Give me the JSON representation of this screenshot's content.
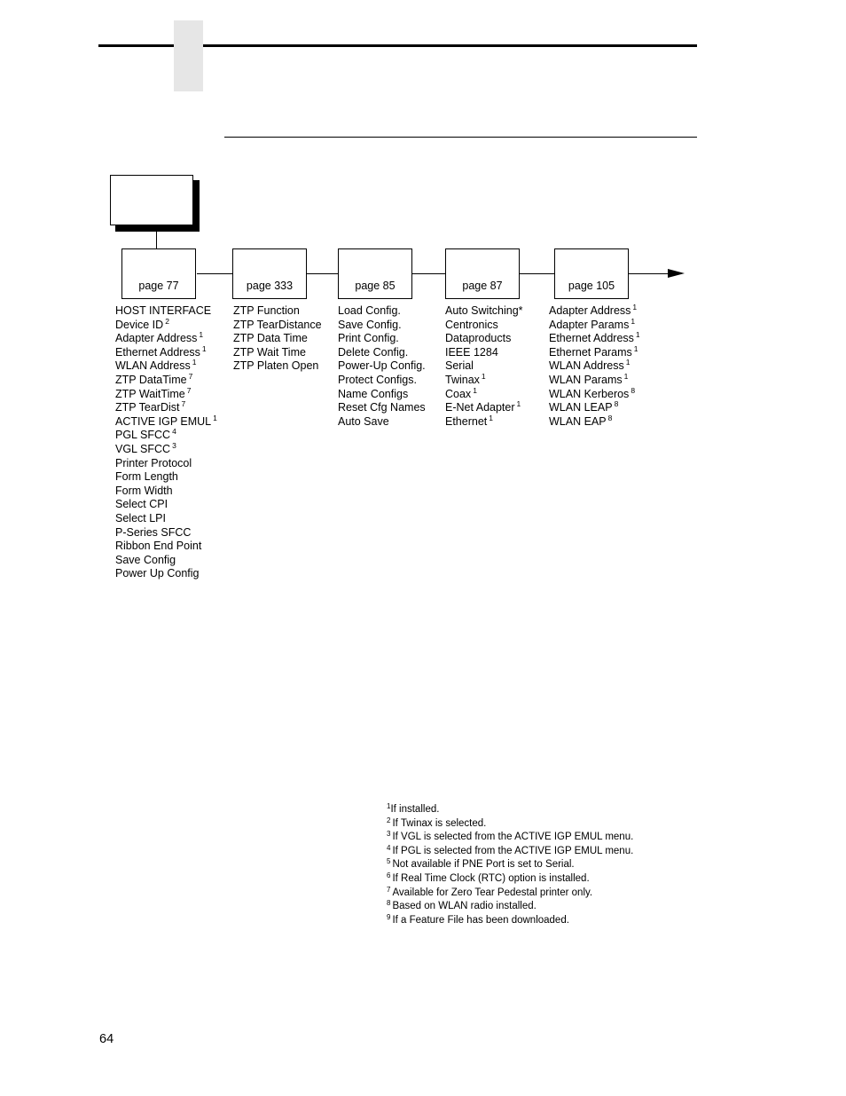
{
  "page_number": "64",
  "root_node": {
    "label": ""
  },
  "nodes": [
    {
      "label": "page 77"
    },
    {
      "label": "page 333"
    },
    {
      "label": "page 85"
    },
    {
      "label": "page 87"
    },
    {
      "label": "page 105"
    }
  ],
  "columns": [
    {
      "items": [
        {
          "text": "HOST INTERFACE",
          "sup": ""
        },
        {
          "text": "Device ID",
          "sup": "2"
        },
        {
          "text": "Adapter Address",
          "sup": "1"
        },
        {
          "text": "Ethernet Address",
          "sup": "1"
        },
        {
          "text": "WLAN Address",
          "sup": "1"
        },
        {
          "text": "ZTP DataTime",
          "sup": "7"
        },
        {
          "text": "ZTP WaitTime",
          "sup": "7"
        },
        {
          "text": "ZTP TearDist",
          "sup": "7"
        },
        {
          "text": "ACTIVE IGP EMUL",
          "sup": "1"
        },
        {
          "text": "PGL SFCC",
          "sup": "4"
        },
        {
          "text": "VGL SFCC",
          "sup": "3"
        },
        {
          "text": "Printer Protocol",
          "sup": ""
        },
        {
          "text": "Form Length",
          "sup": ""
        },
        {
          "text": "Form Width",
          "sup": ""
        },
        {
          "text": "Select CPI",
          "sup": ""
        },
        {
          "text": "Select LPI",
          "sup": ""
        },
        {
          "text": "P-Series SFCC",
          "sup": ""
        },
        {
          "text": "Ribbon End Point",
          "sup": ""
        },
        {
          "text": "Save Config",
          "sup": ""
        },
        {
          "text": "Power Up Config",
          "sup": ""
        }
      ]
    },
    {
      "items": [
        {
          "text": "ZTP Function",
          "sup": ""
        },
        {
          "text": "ZTP TearDistance",
          "sup": ""
        },
        {
          "text": "ZTP Data Time",
          "sup": ""
        },
        {
          "text": "ZTP Wait Time",
          "sup": ""
        },
        {
          "text": "ZTP Platen Open",
          "sup": ""
        }
      ]
    },
    {
      "items": [
        {
          "text": "Load Config.",
          "sup": ""
        },
        {
          "text": "Save Config.",
          "sup": ""
        },
        {
          "text": "Print Config.",
          "sup": ""
        },
        {
          "text": "Delete Config.",
          "sup": ""
        },
        {
          "text": "Power-Up Config.",
          "sup": ""
        },
        {
          "text": "Protect Configs.",
          "sup": ""
        },
        {
          "text": "Name Configs",
          "sup": ""
        },
        {
          "text": "Reset Cfg Names",
          "sup": ""
        },
        {
          "text": "Auto Save",
          "sup": ""
        }
      ]
    },
    {
      "items": [
        {
          "text": "Auto Switching*",
          "sup": ""
        },
        {
          "text": "Centronics",
          "sup": ""
        },
        {
          "text": "Dataproducts",
          "sup": ""
        },
        {
          "text": "IEEE 1284",
          "sup": ""
        },
        {
          "text": "Serial",
          "sup": ""
        },
        {
          "text": "Twinax",
          "sup": "1"
        },
        {
          "text": "Coax",
          "sup": "1"
        },
        {
          "text": "E-Net Adapter",
          "sup": "1"
        },
        {
          "text": "Ethernet",
          "sup": "1"
        }
      ]
    },
    {
      "items": [
        {
          "text": "Adapter Address",
          "sup": "1"
        },
        {
          "text": "Adapter Params",
          "sup": "1"
        },
        {
          "text": "Ethernet Address",
          "sup": "1"
        },
        {
          "text": "Ethernet Params",
          "sup": "1"
        },
        {
          "text": "WLAN Address",
          "sup": "1"
        },
        {
          "text": "WLAN Params",
          "sup": "1"
        },
        {
          "text": "WLAN Kerberos",
          "sup": "8"
        },
        {
          "text": "WLAN LEAP",
          "sup": "8"
        },
        {
          "text": "WLAN EAP",
          "sup": "8"
        }
      ]
    }
  ],
  "footnotes": [
    {
      "num": "1",
      "text": "If installed."
    },
    {
      "num": "2",
      "text": "If Twinax is selected."
    },
    {
      "num": "3",
      "text": "If VGL is selected from the ACTIVE IGP EMUL menu."
    },
    {
      "num": "4",
      "text": "If PGL is selected from the ACTIVE IGP EMUL menu."
    },
    {
      "num": "5",
      "text": "Not available if PNE Port is set to Serial."
    },
    {
      "num": "6",
      "text": "If Real Time Clock (RTC) option is installed."
    },
    {
      "num": "7",
      "text": "Available for Zero Tear Pedestal printer only."
    },
    {
      "num": "8",
      "text": "Based on WLAN radio installed."
    },
    {
      "num": "9",
      "text": "If a Feature File has been downloaded."
    }
  ]
}
